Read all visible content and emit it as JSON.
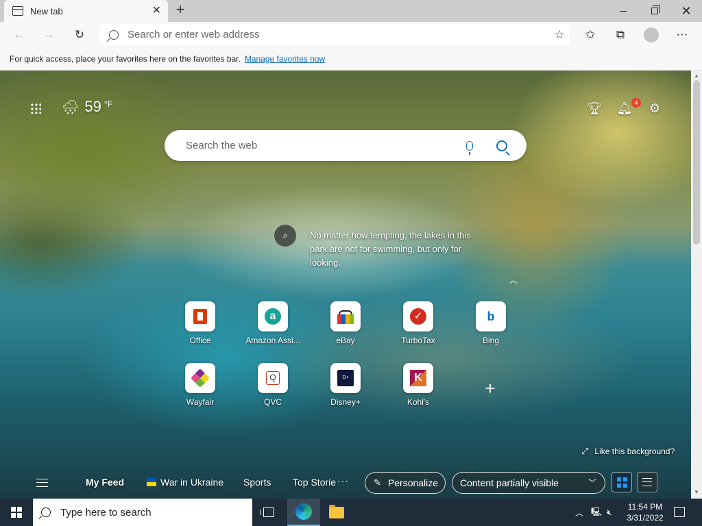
{
  "tab": {
    "title": "New tab"
  },
  "address_bar": {
    "placeholder": "Search or enter web address"
  },
  "favorites_bar": {
    "message": "For quick access, place your favorites here on the favorites bar.",
    "link": "Manage favorites now"
  },
  "weather": {
    "temp": "59",
    "unit": "°F"
  },
  "notifications": {
    "count": "4"
  },
  "web_search": {
    "placeholder": "Search the web"
  },
  "image_caption": "No matter how tempting, the lakes in this park are not for swimming, but only for looking.",
  "quick_links": [
    {
      "label": "Office",
      "logo": "office"
    },
    {
      "label": "Amazon Assi...",
      "logo": "amazon"
    },
    {
      "label": "eBay",
      "logo": "ebay"
    },
    {
      "label": "TurboTax",
      "logo": "turbotax"
    },
    {
      "label": "Bing",
      "logo": "bing"
    },
    {
      "label": "Wayfair",
      "logo": "wayfair"
    },
    {
      "label": "QVC",
      "logo": "qvc"
    },
    {
      "label": "Disney+",
      "logo": "disney"
    },
    {
      "label": "Kohl's",
      "logo": "kohls"
    }
  ],
  "like_background": "Like this background?",
  "feed": {
    "items": [
      "My Feed",
      "War in Ukraine",
      "Sports",
      "Top Storie"
    ],
    "more": "···",
    "personalize": "Personalize",
    "content_visibility": "Content partially visible"
  },
  "taskbar": {
    "search_placeholder": "Type here to search",
    "time": "11:54 PM",
    "date": "3/31/2022"
  }
}
